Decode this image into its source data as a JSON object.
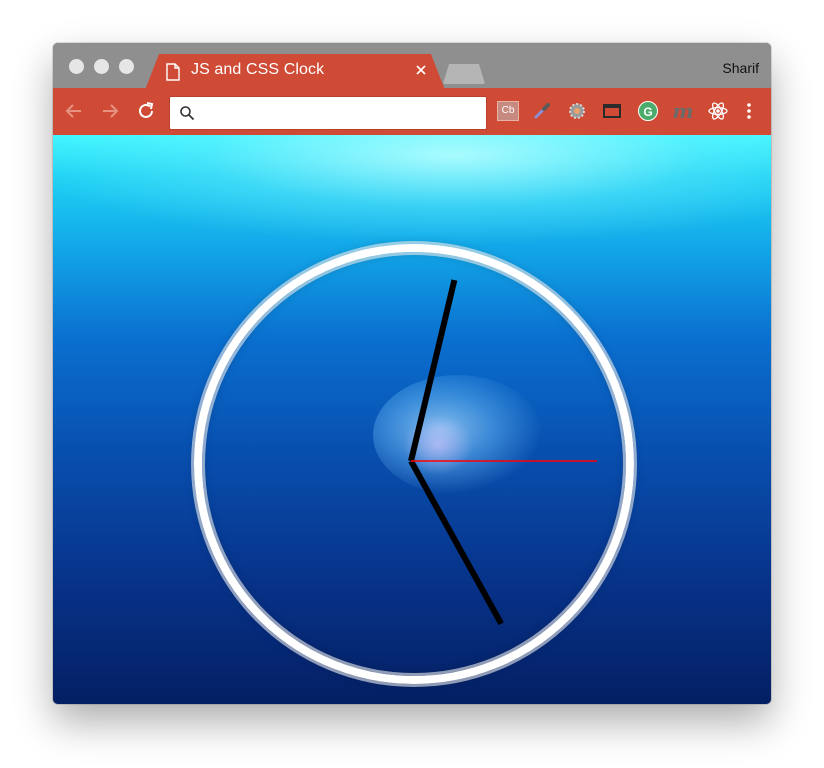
{
  "window": {
    "profile_name": "Sharif"
  },
  "tab": {
    "title": "JS and CSS Clock",
    "icon": "file-icon",
    "close_icon": "close-icon"
  },
  "toolbar": {
    "back_icon": "back-arrow-icon",
    "forward_icon": "forward-arrow-icon",
    "reload_icon": "reload-icon",
    "omnibox_value": "",
    "omnibox_icon": "search-icon",
    "extensions": [
      {
        "name": "cb-extension-icon",
        "text": "Cb"
      },
      {
        "name": "eyedropper-icon"
      },
      {
        "name": "gear-extension-icon"
      },
      {
        "name": "window-resize-icon"
      },
      {
        "name": "grammarly-icon",
        "text": "G"
      },
      {
        "name": "m-extension-icon",
        "text": "m"
      },
      {
        "name": "react-devtools-icon"
      },
      {
        "name": "chrome-menu-icon"
      }
    ]
  },
  "clock": {
    "hour": 5,
    "minute": 2,
    "second": 15,
    "face_color": "#ffffff",
    "hand_color": "#000000",
    "second_hand_color": "#ff0000"
  },
  "colors": {
    "tab_accent": "#cf4b35",
    "titlebar": "#8f8f8f"
  }
}
